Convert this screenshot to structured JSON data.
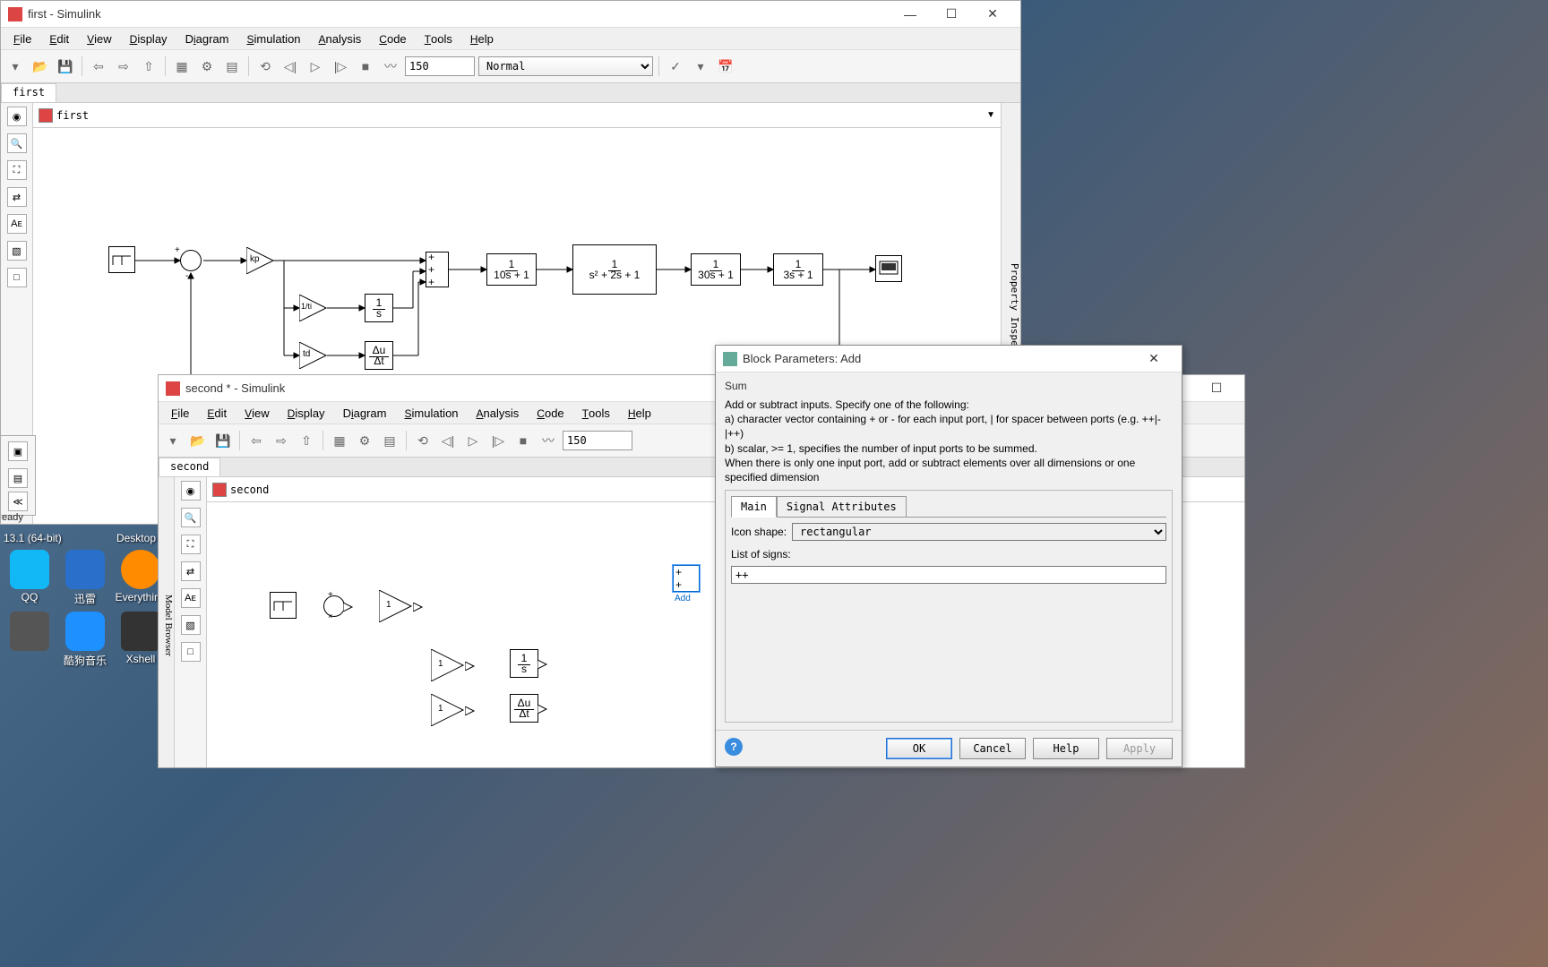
{
  "win1": {
    "title": "first - Simulink",
    "breadcrumb": "first",
    "tab": "first",
    "menu": {
      "file": "File",
      "edit": "Edit",
      "view": "View",
      "display": "Display",
      "diagram": "Diagram",
      "simulation": "Simulation",
      "analysis": "Analysis",
      "code": "Code",
      "tools": "Tools",
      "help": "Help"
    },
    "stoptime": "150",
    "simmode": "Normal",
    "prop_inspector": "Property Inspector",
    "blocks": {
      "tf1": {
        "num": "1",
        "den": "10s + 1"
      },
      "tf2": {
        "num": "1",
        "den": "s² + 2s + 1"
      },
      "tf3": {
        "num": "1",
        "den": "30s + 1"
      },
      "tf4": {
        "num": "1",
        "den": "3s + 1"
      },
      "integ": {
        "num": "1",
        "den": "s"
      },
      "deriv": {
        "num": "Δu",
        "den": "Δt"
      },
      "kp": "kp",
      "kti": "1/ti",
      "ktd": "td"
    }
  },
  "win2": {
    "title": "second * - Simulink",
    "breadcrumb": "second",
    "tab": "second",
    "menu": {
      "file": "File",
      "edit": "Edit",
      "view": "View",
      "display": "Display",
      "diagram": "Diagram",
      "simulation": "Simulation",
      "analysis": "Analysis",
      "code": "Code",
      "tools": "Tools",
      "help": "Help"
    },
    "stoptime": "150",
    "model_browser": "Model Browser",
    "blocks": {
      "g1": "1",
      "g2": "1",
      "g3": "1",
      "integ": {
        "num": "1",
        "den": "s"
      },
      "deriv": {
        "num": "Δu",
        "den": "Δt"
      },
      "add_label": "Add"
    }
  },
  "dialog": {
    "title": "Block Parameters: Add",
    "heading": "Sum",
    "desc1": "Add or subtract inputs.  Specify one of the following:",
    "desc2": "a) character vector containing + or - for each input port, | for spacer between ports (e.g. ++|-|++)",
    "desc3": "b) scalar, >= 1, specifies the number of input ports to be summed.",
    "desc4": "When there is only one input port, add or subtract elements over all dimensions or one specified dimension",
    "tab_main": "Main",
    "tab_sig": "Signal Attributes",
    "icon_shape_label": "Icon shape:",
    "icon_shape": "rectangular",
    "list_label": "List of signs:",
    "list_value": "++",
    "ok": "OK",
    "cancel": "Cancel",
    "help": "Help",
    "apply": "Apply"
  },
  "desktop": {
    "qq": "QQ",
    "xunlei": "迅雷",
    "everything": "Everything",
    "title64": "13.1 (64-bit)",
    "desk": "Desktop",
    "kugou": "酷狗音乐",
    "xshell": "Xshell"
  },
  "status": "eady"
}
